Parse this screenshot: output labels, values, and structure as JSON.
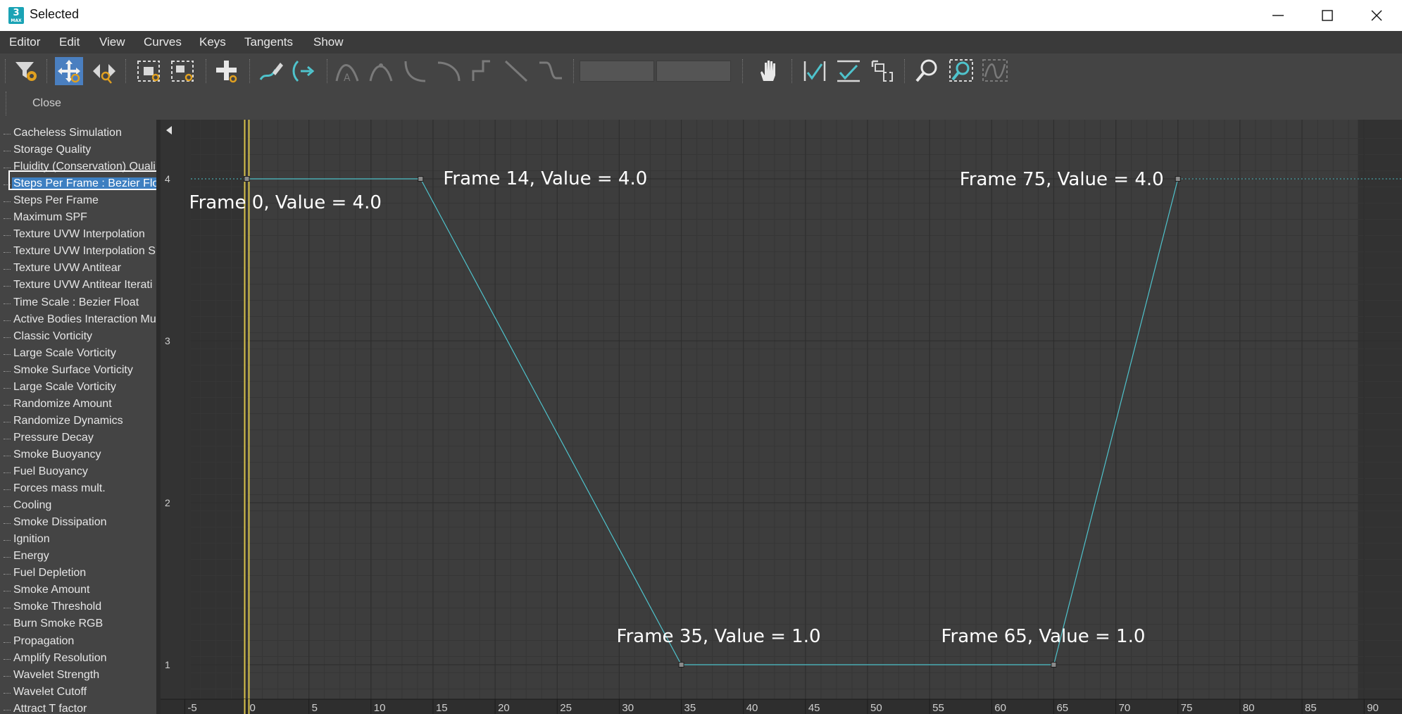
{
  "window": {
    "title": "Selected",
    "logo_text": "3",
    "logo_subtext": "MAX"
  },
  "menu": [
    "Editor",
    "Edit",
    "View",
    "Curves",
    "Keys",
    "Tangents",
    "Show"
  ],
  "toolbar2": {
    "close_label": "Close"
  },
  "controllers": [
    "Cacheless Simulation",
    "Storage Quality",
    "Fluidity (Conservation) Quali",
    "Steps Per Frame : Bezier Floa",
    "Steps Per Frame",
    "Maximum SPF",
    "Texture UVW Interpolation",
    "Texture UVW Interpolation S",
    "Texture UVW Antitear",
    "Texture UVW Antitear Iterati",
    "Time Scale : Bezier Float",
    "Active Bodies Interaction Mu",
    "Classic Vorticity",
    "Large Scale Vorticity",
    "Smoke Surface Vorticity",
    "Large Scale Vorticity",
    "Randomize Amount",
    "Randomize Dynamics",
    "Pressure Decay",
    "Smoke Buoyancy",
    "Fuel Buoyancy",
    "Forces mass mult.",
    "Cooling",
    "Smoke Dissipation",
    "Ignition",
    "Energy",
    "Fuel Depletion",
    "Smoke Amount",
    "Smoke Threshold",
    "Burn Smoke RGB",
    "Propagation",
    "Amplify Resolution",
    "Wavelet Strength",
    "Wavelet Cutoff",
    "Attract T factor"
  ],
  "selected_index": 3,
  "icons": {
    "filters": "filter-gear-icon",
    "move_keys": "move-keys-icon",
    "slide_keys": "slide-keys-icon",
    "scale_keys": "scale-keys-icon",
    "scale_values": "scale-values-icon",
    "add_keys": "add-keys-icon",
    "draw_curves": "draw-curves-icon",
    "reduce_keys": "reduce-keys-icon",
    "pan": "hand-icon",
    "zoom": "magnifier-icon",
    "zoom_region": "zoom-region-icon"
  },
  "colors": {
    "curve": "#4fc3cc",
    "time_slider": "#d8c24a",
    "selection": "#3d7fc1",
    "toolbar_active": "#4a7fc0"
  },
  "chart_data": {
    "type": "line",
    "x_axis_ticks": [
      -5,
      0,
      5,
      10,
      15,
      20,
      25,
      30,
      35,
      40,
      45,
      50,
      55,
      60,
      65,
      70,
      75,
      80,
      85,
      90
    ],
    "y_axis_ticks": [
      1,
      2,
      3,
      4
    ],
    "xlim": [
      -7.5,
      92.5
    ],
    "ylim": [
      0.8,
      4.35
    ],
    "current_frame": 0,
    "series": [
      {
        "points": [
          {
            "x": 0,
            "y": 4.0
          },
          {
            "x": 14,
            "y": 4.0
          },
          {
            "x": 35,
            "y": 1.0
          },
          {
            "x": 65,
            "y": 1.0
          },
          {
            "x": 75,
            "y": 4.0
          }
        ]
      }
    ],
    "annotations": [
      {
        "text": "Frame 0, Value = 4.0",
        "x": 0,
        "y": 4.0
      },
      {
        "text": "Frame 14, Value = 4.0",
        "x": 14,
        "y": 4.0
      },
      {
        "text": "Frame 35, Value = 1.0",
        "x": 35,
        "y": 1.0
      },
      {
        "text": "Frame 65, Value = 1.0",
        "x": 65,
        "y": 1.0
      },
      {
        "text": "Frame 75, Value = 4.0",
        "x": 75,
        "y": 4.0
      }
    ]
  }
}
